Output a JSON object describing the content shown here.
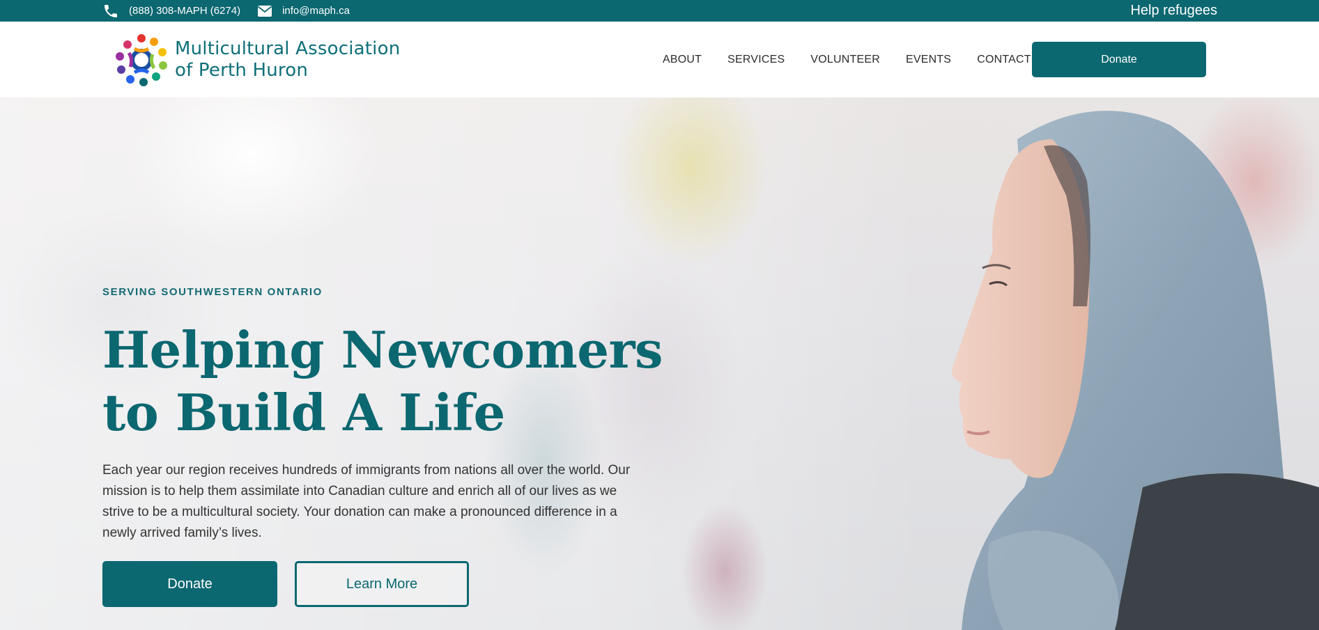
{
  "topbar": {
    "phone": "(888) 308-MAPH (6274)",
    "email": "info@maph.ca",
    "help_link": "Help refugees"
  },
  "header": {
    "logo_line1": "Multicultural Association",
    "logo_line2": "of Perth Huron",
    "nav": [
      "ABOUT",
      "SERVICES",
      "VOLUNTEER",
      "EVENTS",
      "CONTACT"
    ],
    "donate_label": "Donate"
  },
  "hero": {
    "eyebrow": "SERVING SOUTHWESTERN ONTARIO",
    "headline_line1": "Helping Newcomers",
    "headline_line2": "to Build A Life",
    "body": "Each year our region receives hundreds of immigrants from nations all over the world. Our mission is to help them assimilate into Canadian culture and enrich all of our lives as we strive to be a multicultural society. Your donation can make a pronounced difference in a newly arrived family’s lives.",
    "donate_label": "Donate",
    "learn_more_label": "Learn More"
  },
  "colors": {
    "brand_teal": "#0b6770",
    "text_dark": "#333333"
  },
  "icons": [
    "phone-icon",
    "mail-icon",
    "logo-icon"
  ]
}
